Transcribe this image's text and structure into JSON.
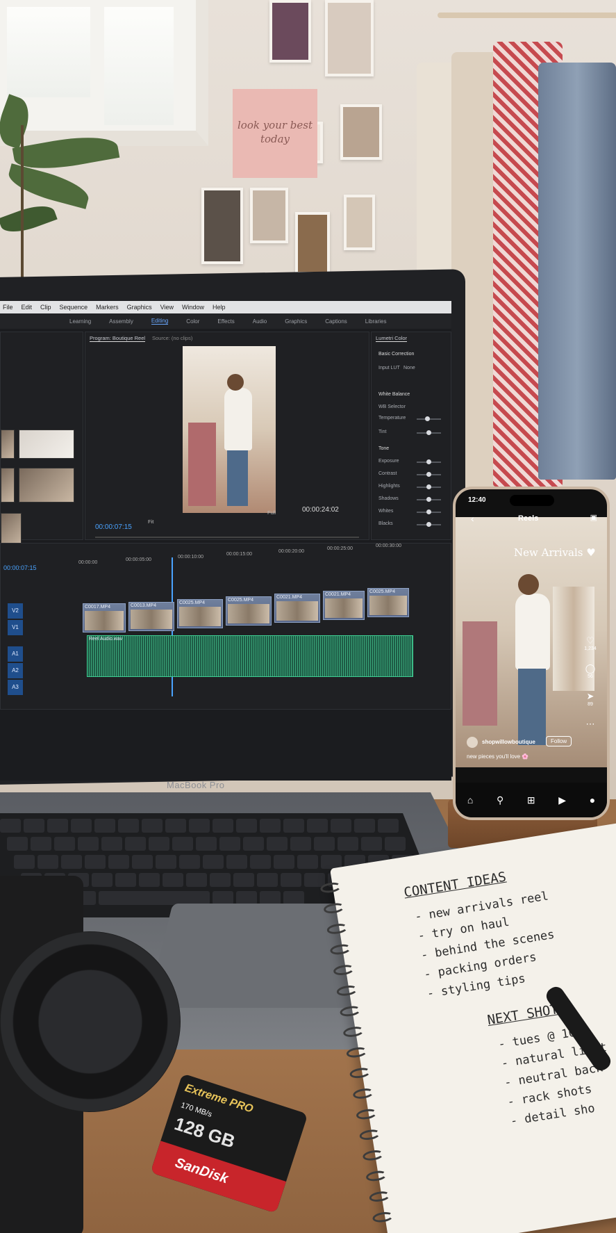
{
  "wall": {
    "note_text": "look your best today"
  },
  "laptop": {
    "brand": "MacBook Pro",
    "menu": [
      "File",
      "Edit",
      "Clip",
      "Sequence",
      "Markers",
      "Graphics",
      "View",
      "Window",
      "Help"
    ],
    "workspaces": [
      "Learning",
      "Assembly",
      "Editing",
      "Color",
      "Effects",
      "Audio",
      "Graphics",
      "Captions",
      "Libraries"
    ],
    "active_workspace": "Editing",
    "program_tab": "Program: Boutique Reel",
    "source_tab": "Source: (no clips)",
    "timecode_left": "00:00:07:15",
    "timecode_right": "00:00:24:02",
    "fit": "Fit",
    "full": "Full",
    "lumetri": {
      "title": "Lumetri Color",
      "section": "Basic Correction",
      "input_lut_label": "Input LUT",
      "input_lut_value": "None",
      "white_balance": "White Balance",
      "wb_selector": "WB Selector",
      "temperature": "Temperature",
      "tint": "Tint",
      "tone": "Tone",
      "exposure": "Exposure",
      "contrast": "Contrast",
      "highlights": "Highlights",
      "shadows": "Shadows",
      "whites": "Whites",
      "blacks": "Blacks"
    },
    "timeline": {
      "timecode": "00:00:07:15",
      "ruler": [
        "00:00:00",
        "00:00:05:00",
        "00:00:10:00",
        "00:00:15:00",
        "00:00:20:00",
        "00:00:25:00",
        "00:00:30:00"
      ],
      "clips_row1": [
        "C0025.MP4",
        "C0025.MP4",
        "C0021.MP4",
        "C0021.MP4",
        "C0025.MP4"
      ],
      "clips_row2": [
        "C0017.MP4",
        "C0013.MP4",
        "C0025.MP4",
        "C0025.MP4",
        "C0021.MP4",
        "C0021.MP4",
        "C0025.MP4"
      ],
      "audio_clip": "Reel Audio.wav",
      "tracks": [
        "V2",
        "V1",
        "A1",
        "A2",
        "A3"
      ]
    }
  },
  "phone": {
    "time": "12:40",
    "header": "Reels",
    "overlay": "New Arrivals ♥",
    "likes": "1,234",
    "comments": "56",
    "shares": "89",
    "username": "shopwillowboutique",
    "follow": "Follow",
    "caption": "new pieces you'll love 🌸"
  },
  "notebook": {
    "heading1": "CONTENT IDEAS",
    "ideas": [
      "- new arrivals reel",
      "- try on haul",
      "- behind the scenes",
      "- packing orders",
      "- styling tips"
    ],
    "heading2": "NEXT SHOT",
    "shots": [
      "- tues @ 10am",
      "- natural light",
      "- neutral back",
      "- rack shots",
      "- detail sho"
    ]
  },
  "sdcard": {
    "line1": "Extreme PRO",
    "speed": "170 MB/s",
    "capacity": "128 GB",
    "brand": "SanDisk"
  }
}
